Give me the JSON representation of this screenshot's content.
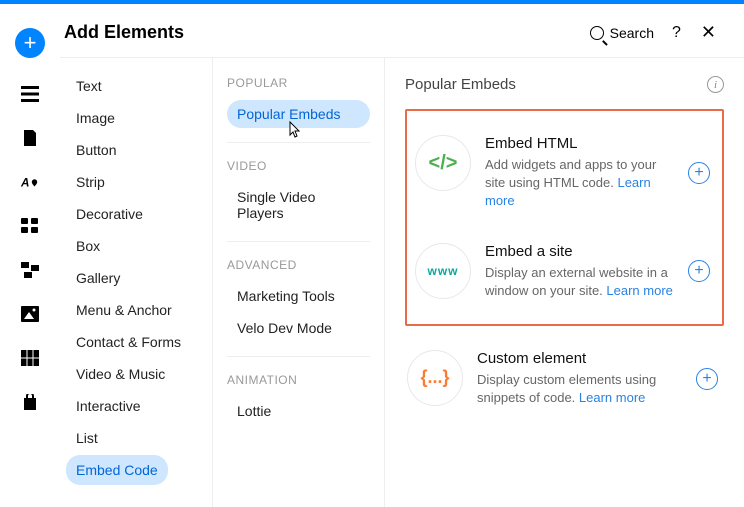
{
  "header": {
    "title": "Add Elements",
    "search": "Search",
    "help": "?",
    "close": "✕"
  },
  "rail_add": "+",
  "rail_icons": [
    "section-icon",
    "page-icon",
    "styles-icon",
    "apps-icon",
    "dev-icon",
    "media-icon",
    "data-icon",
    "store-icon"
  ],
  "categories": [
    {
      "label": "Text",
      "active": false
    },
    {
      "label": "Image",
      "active": false
    },
    {
      "label": "Button",
      "active": false
    },
    {
      "label": "Strip",
      "active": false
    },
    {
      "label": "Decorative",
      "active": false
    },
    {
      "label": "Box",
      "active": false
    },
    {
      "label": "Gallery",
      "active": false
    },
    {
      "label": "Menu & Anchor",
      "active": false
    },
    {
      "label": "Contact & Forms",
      "active": false
    },
    {
      "label": "Video & Music",
      "active": false
    },
    {
      "label": "Interactive",
      "active": false
    },
    {
      "label": "List",
      "active": false
    },
    {
      "label": "Embed Code",
      "active": true
    }
  ],
  "groups": [
    {
      "label": "Popular",
      "items": [
        {
          "label": "Popular Embeds",
          "active": true,
          "cursor": true
        }
      ]
    },
    {
      "label": "Video",
      "items": [
        {
          "label": "Single Video Players",
          "active": false
        }
      ]
    },
    {
      "label": "Advanced",
      "items": [
        {
          "label": "Marketing Tools",
          "active": false
        },
        {
          "label": "Velo Dev Mode",
          "active": false
        }
      ]
    },
    {
      "label": "Animation",
      "items": [
        {
          "label": "Lottie",
          "active": false
        }
      ]
    }
  ],
  "panel_title": "Popular Embeds",
  "cards": [
    {
      "icon": "</>",
      "css": "html",
      "title": "Embed HTML",
      "desc": "Add widgets and apps to your site using HTML code.",
      "learn": "Learn more",
      "hi": true
    },
    {
      "icon": "www",
      "css": "www",
      "title": "Embed a site",
      "desc": "Display an external website in a window on your site.",
      "learn": "Learn more",
      "hi": true
    },
    {
      "icon": "{...}",
      "css": "custom",
      "title": "Custom element",
      "desc": "Display custom elements using snippets of code.",
      "learn": "Learn more",
      "hi": false
    }
  ]
}
